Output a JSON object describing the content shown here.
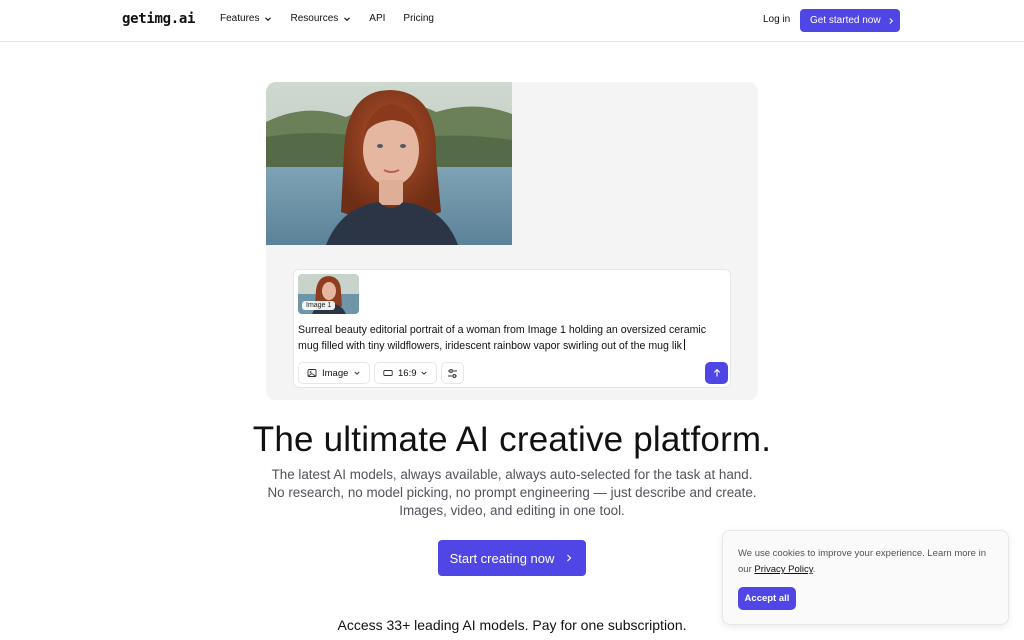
{
  "header": {
    "logo": "getimg.ai",
    "nav": [
      {
        "label": "Features",
        "has_dropdown": true
      },
      {
        "label": "Resources",
        "has_dropdown": true
      },
      {
        "label": "API",
        "has_dropdown": false
      },
      {
        "label": "Pricing",
        "has_dropdown": false
      }
    ],
    "login": "Log in",
    "cta": "Get started now"
  },
  "hero": {
    "thumb_label": "Image 1",
    "prompt_text": "Surreal beauty editorial portrait of a woman from Image 1 holding an oversized ceramic mug filled with tiny wildflowers, iridescent rainbow vapor swirling out of the mug lik",
    "mode_select": "Image",
    "ratio_select": "16:9",
    "icons": {
      "mode": "image-icon",
      "ratio": "aspect-ratio-icon",
      "settings": "sliders-icon",
      "send": "arrow-up-icon"
    }
  },
  "main": {
    "headline": "The ultimate AI creative platform.",
    "subtext": "The latest AI models, always available, always auto-selected for the task at hand. No research, no model picking, no prompt engineering — just describe and create. Images, video, and editing in one tool.",
    "cta": "Start creating now",
    "access": "Access 33+ leading AI models. Pay for one subscription."
  },
  "cookie": {
    "text": "We use cookies to improve your experience. Learn more in our",
    "link": "Privacy Policy",
    "suffix": ".",
    "button": "Accept all"
  },
  "colors": {
    "accent": "#4f46e5",
    "border": "#e5e7eb",
    "muted_text": "#52525b"
  }
}
